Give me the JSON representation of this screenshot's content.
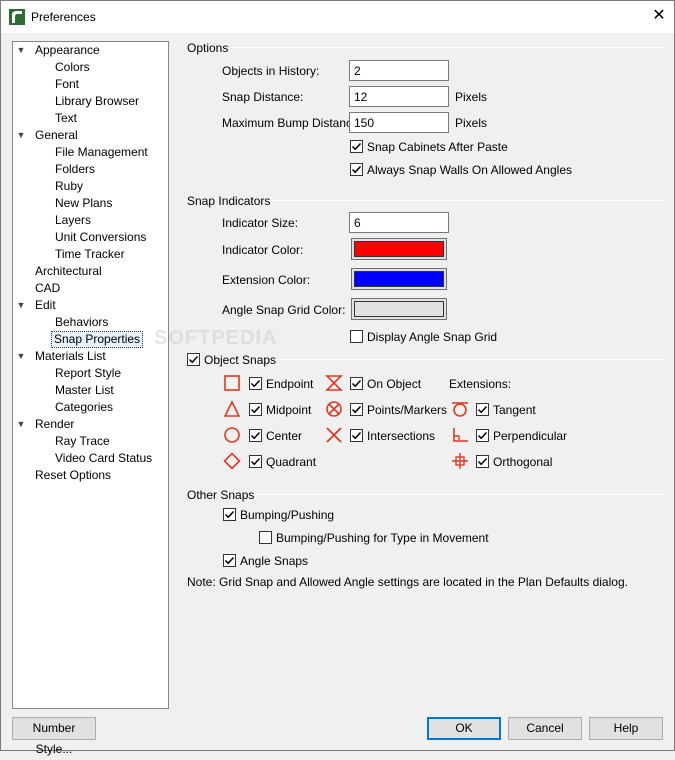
{
  "window": {
    "title": "Preferences"
  },
  "watermark": "SOFTPEDIA",
  "tree": {
    "appearance": "Appearance",
    "colors": "Colors",
    "font": "Font",
    "library_browser": "Library Browser",
    "text": "Text",
    "general": "General",
    "file_management": "File Management",
    "folders": "Folders",
    "ruby": "Ruby",
    "new_plans": "New Plans",
    "layers": "Layers",
    "unit_conversions": "Unit Conversions",
    "time_tracker": "Time Tracker",
    "architectural": "Architectural",
    "cad": "CAD",
    "edit": "Edit",
    "behaviors": "Behaviors",
    "snap_properties": "Snap Properties",
    "materials_list": "Materials List",
    "report_style": "Report Style",
    "master_list": "Master List",
    "categories": "Categories",
    "render": "Render",
    "ray_trace": "Ray Trace",
    "video_card_status": "Video Card Status",
    "reset_options": "Reset Options"
  },
  "options": {
    "title": "Options",
    "objects_history_label": "Objects in History:",
    "objects_history_value": "2",
    "snap_distance_label": "Snap Distance:",
    "snap_distance_value": "12",
    "snap_distance_unit": "Pixels",
    "max_bump_label": "Maximum Bump Distance:",
    "max_bump_value": "150",
    "max_bump_unit": "Pixels",
    "snap_cabinets_label": "Snap Cabinets After Paste",
    "snap_cabinets_checked": true,
    "always_snap_label": "Always Snap Walls On Allowed Angles",
    "always_snap_checked": true
  },
  "snap_indicators": {
    "title": "Snap Indicators",
    "indicator_size_label": "Indicator Size:",
    "indicator_size_value": "6",
    "indicator_color_label": "Indicator Color:",
    "indicator_color": "#ff0000",
    "extension_color_label": "Extension Color:",
    "extension_color": "#0000ff",
    "angle_grid_color_label": "Angle Snap Grid Color:",
    "angle_grid_color": "#e0e0e0",
    "display_angle_grid_label": "Display Angle Snap Grid",
    "display_angle_grid_checked": false
  },
  "object_snaps": {
    "title": "Object Snaps",
    "checked": true,
    "endpoint": "Endpoint",
    "midpoint": "Midpoint",
    "center": "Center",
    "quadrant": "Quadrant",
    "on_object": "On Object",
    "points_markers": "Points/Markers",
    "intersections": "Intersections",
    "extensions_label": "Extensions:",
    "tangent": "Tangent",
    "perpendicular": "Perpendicular",
    "orthogonal": "Orthogonal",
    "icon_color": "#e0391f"
  },
  "other_snaps": {
    "title": "Other Snaps",
    "bumping_label": "Bumping/Pushing",
    "bumping_checked": true,
    "bumping_type_label": "Bumping/Pushing for Type in Movement",
    "bumping_type_checked": false,
    "angle_snaps_label": "Angle Snaps",
    "angle_snaps_checked": true,
    "note": "Note: Grid Snap and Allowed Angle settings are located in the Plan Defaults dialog."
  },
  "buttons": {
    "number_style": "Number Style...",
    "ok": "OK",
    "cancel": "Cancel",
    "help": "Help"
  }
}
